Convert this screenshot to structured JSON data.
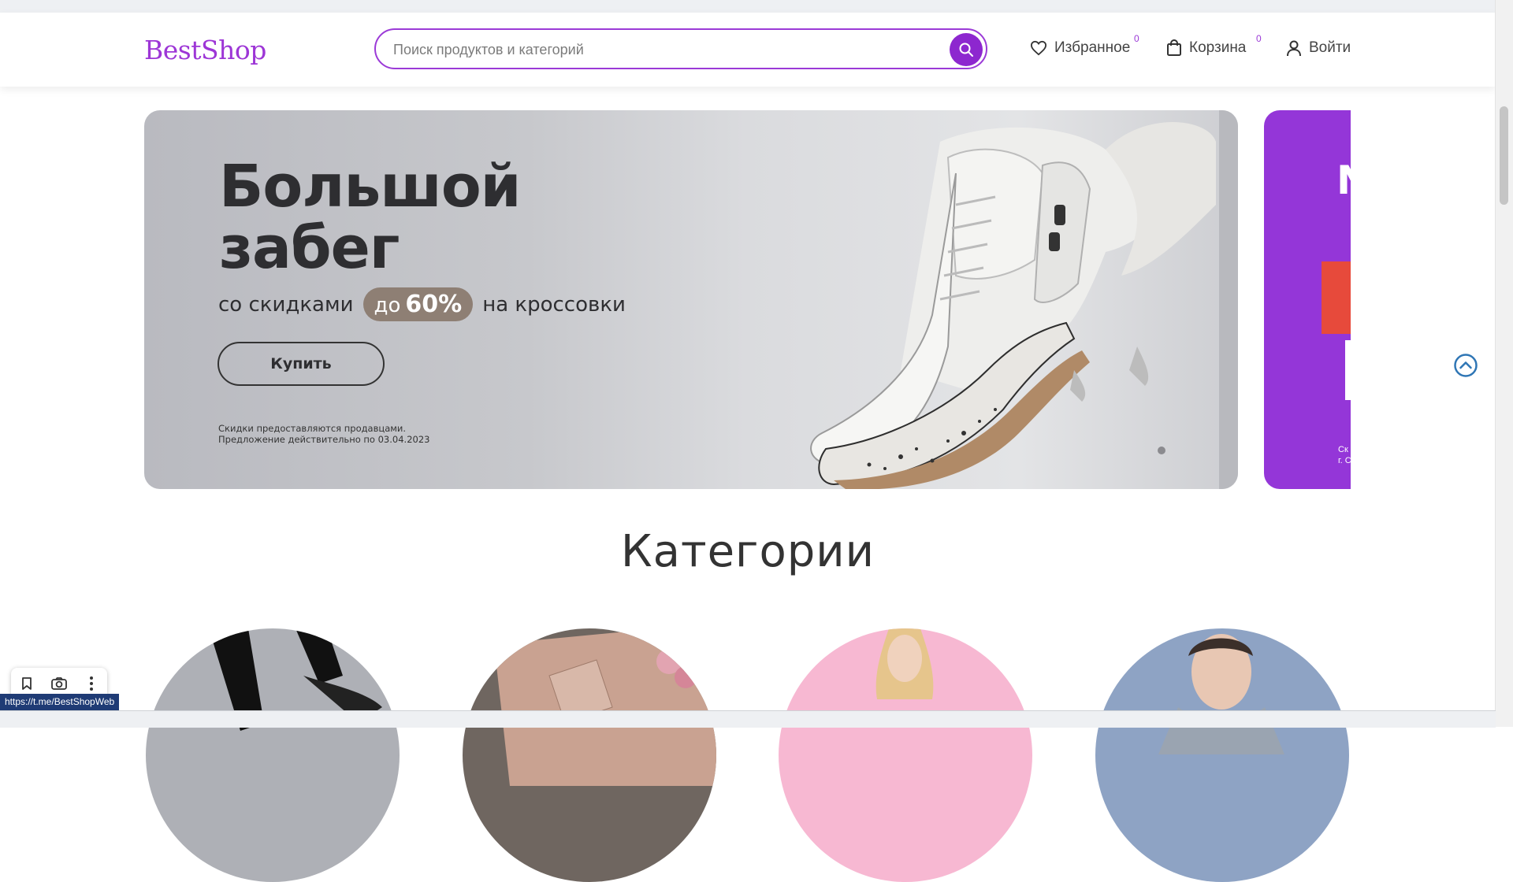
{
  "header": {
    "logo": "BestShop",
    "search": {
      "placeholder": "Поиск продуктов и категорий"
    },
    "nav": {
      "favorites": {
        "label": "Избранное",
        "count": "0"
      },
      "cart": {
        "label": "Корзина",
        "count": "0"
      },
      "login": {
        "label": "Войти"
      }
    }
  },
  "banner": {
    "title_line1": "Большой",
    "title_line2": "забег",
    "subtitle_before": "со скидками",
    "pill_prefix": "до",
    "pill_percent": "60%",
    "subtitle_after": "на кроссовки",
    "button": "Купить",
    "fine_line1": "Скидки предоставляются продавцами.",
    "fine_line2": "Предложение действительно по 03.04.2023"
  },
  "banner2": {
    "letter": "N",
    "small_line1": "Ск",
    "small_line2": "г. С"
  },
  "categories": {
    "title": "Категории"
  },
  "status_bar": {
    "url": "https://t.me/BestShopWeb"
  },
  "colors": {
    "brand": "#9d36d6",
    "search_button": "#8d27cf",
    "banner2_bg": "#9436d8",
    "up_button": "#2f76b5"
  }
}
